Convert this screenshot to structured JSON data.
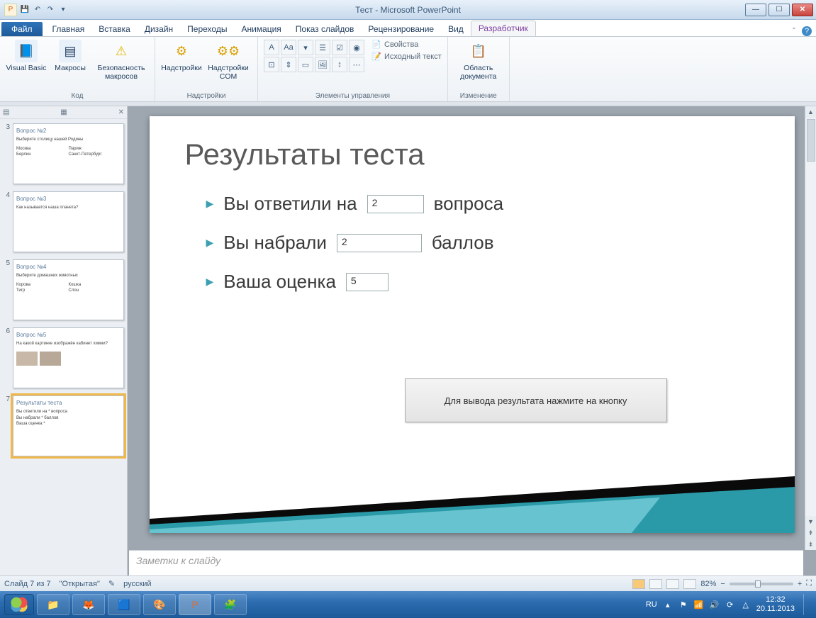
{
  "window": {
    "title": "Тест - Microsoft PowerPoint"
  },
  "ribbon": {
    "file": "Файл",
    "tabs": [
      "Главная",
      "Вставка",
      "Дизайн",
      "Переходы",
      "Анимация",
      "Показ слайдов",
      "Рецензирование",
      "Вид",
      "Разработчик"
    ],
    "active_tab": "Разработчик",
    "groups": {
      "code": {
        "label": "Код",
        "visual_basic": "Visual Basic",
        "macros": "Макросы",
        "security": "Безопасность макросов"
      },
      "addins": {
        "label": "Надстройки",
        "addins": "Надстройки",
        "com_addins": "Надстройки COM"
      },
      "controls": {
        "label": "Элементы управления",
        "properties": "Свойства",
        "view_code": "Исходный текст"
      },
      "modify": {
        "label": "Изменение",
        "doc_panel": "Область документа"
      }
    }
  },
  "thumb_panel": {
    "slides": [
      {
        "num": "3",
        "title": "Вопрос №2",
        "body": "Выберите столицу нашей Родины",
        "opts": [
          "Москва",
          "Париж",
          "Берлин",
          "Санкт-Петербург"
        ]
      },
      {
        "num": "4",
        "title": "Вопрос №3",
        "body": "Как называется наша планета?",
        "opts": []
      },
      {
        "num": "5",
        "title": "Вопрос №4",
        "body": "Выберите домашних животных",
        "opts": [
          "Корова",
          "Кошка",
          "Тигр",
          "Слон"
        ]
      },
      {
        "num": "6",
        "title": "Вопрос №5",
        "body": "На какой картинке изображён кабинет химии?",
        "opts": []
      },
      {
        "num": "7",
        "title": "Результаты теста",
        "body": "",
        "opts": [
          "Вы ответили на * вопроса",
          "Вы набрали * баллов",
          "Ваша оценка *"
        ]
      }
    ],
    "selected": "7"
  },
  "slide": {
    "title": "Результаты теста",
    "line1_a": "Вы ответили на",
    "line1_val": "2",
    "line1_b": "вопроса",
    "line2_a": "Вы набрали",
    "line2_val": "2",
    "line2_b": "баллов",
    "line3_a": "Ваша оценка",
    "line3_val": "5",
    "button": "Для вывода результата нажмите на кнопку"
  },
  "notes": {
    "placeholder": "Заметки к слайду"
  },
  "status": {
    "slide": "Слайд 7 из 7",
    "theme": "\"Открытая\"",
    "language": "русский",
    "zoom": "82%"
  },
  "taskbar": {
    "lang": "RU",
    "time": "12:32",
    "date": "20.11.2013"
  }
}
